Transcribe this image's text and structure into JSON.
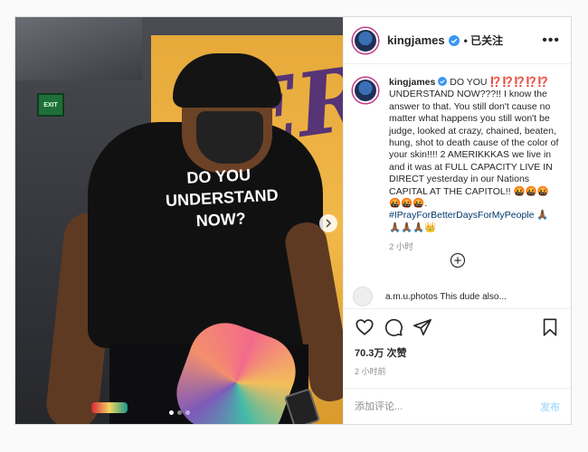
{
  "photo": {
    "exit_sign": "EXIT",
    "banner_letters": "ERS",
    "shirt_text": "DO YOU UNDERSTAND NOW?",
    "carousel": {
      "count": 3,
      "active_index": 0
    }
  },
  "header": {
    "username": "kingjames",
    "follow_label": "• 已关注",
    "more_label": "•••"
  },
  "caption": {
    "username": "kingjames",
    "text": " DO YOU ⁉️⁉️⁉️⁉️⁉️ UNDERSTAND NOW???!! I know the answer to that. You still don't cause no matter what happens you still won't be judge, looked at crazy, chained, beaten, hung, shot to death cause of the color of your skin!!!! 2 AMERIKKKAS we live in and it was at FULL CAPACITY LIVE IN DIRECT yesterday in our Nations CAPITAL AT THE CAPITOL!! 🤬🤬🤬🤬🤬🤬. ",
    "hashtag": "#IPrayForBetterDaysForMyPeople",
    "trailing": " 🙏🏾🙏🏾🙏🏾🙏🏾👑",
    "time": "2 小时"
  },
  "next_comment": {
    "text": "a.m.u.photos This dude also..."
  },
  "stats": {
    "likes": "70.3万 次赞",
    "time_ago": "2 小时前"
  },
  "comment_box": {
    "placeholder": "添加评论...",
    "post_label": "发布"
  },
  "colors": {
    "accent_blue": "#0095f6",
    "post_disabled": "#b2dffc",
    "verified_blue": "#3897f0",
    "hashtag": "#00376b"
  }
}
